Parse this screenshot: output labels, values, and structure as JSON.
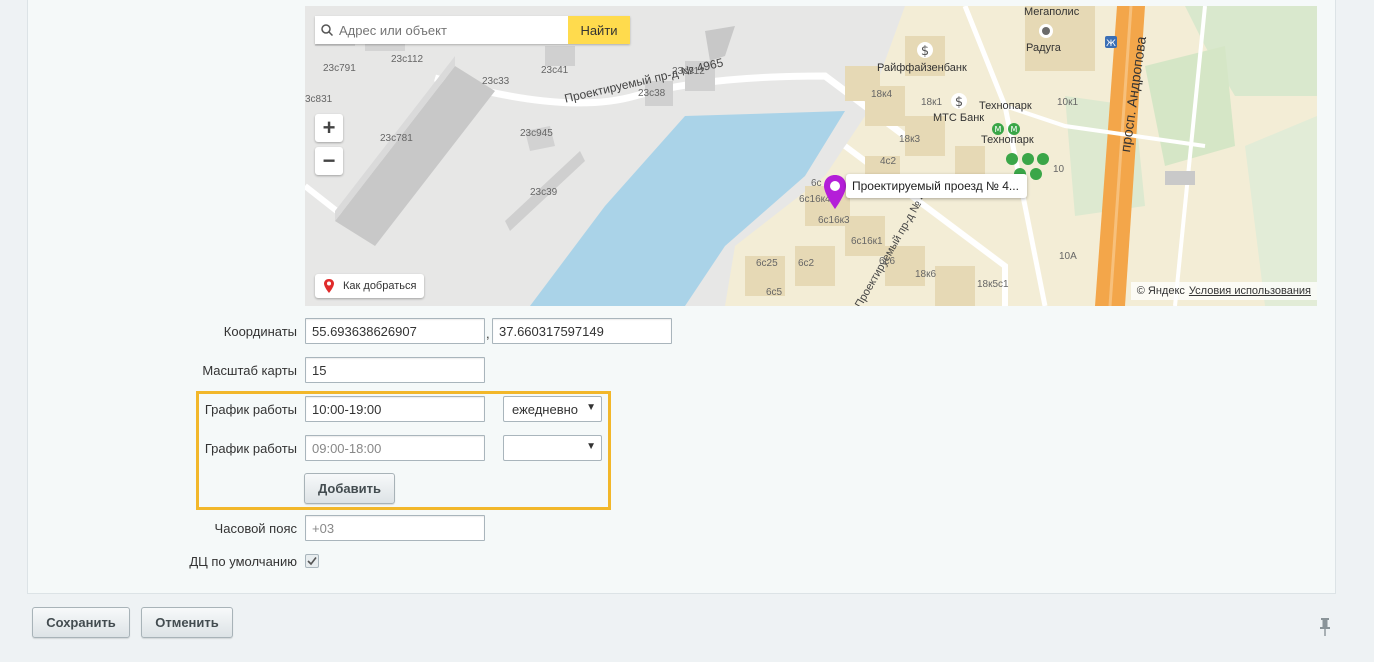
{
  "map": {
    "search_placeholder": "Адрес или объект",
    "search_button": "Найти",
    "zoom_in": "+",
    "zoom_out": "−",
    "route_button": "Как добраться",
    "balloon_text": "Проектируемый проезд № 4...",
    "copyright": "© Яндекс",
    "terms_link": "Условия использования",
    "labels": {
      "b1": "23с791",
      "b2": "23с112",
      "b3": "23с33",
      "b4": "23с41",
      "b5": "23с712",
      "b6": "23с38",
      "b7": "3с831",
      "b8": "23с781",
      "b9": "23с945",
      "b10": "23с39",
      "road1": "Проектируемый пр-д № 4965",
      "road2": "просп. Андропова",
      "road3": "Проектируемый пр-д № 4",
      "poi1": "Мегаполис",
      "poi2": "Радуга",
      "poi3": "Райффайзенбанк",
      "poi4": "МТС Банк",
      "poi5": "Технопарк",
      "poi6": "Технопарк",
      "b11": "18к4",
      "b12": "18к1",
      "b13": "18к3",
      "b14": "10к1",
      "b15": "4с2",
      "b16": "6с16к4",
      "b17": "6с16к3",
      "b18": "6с16к1",
      "b19": "6с25",
      "b20": "6с2",
      "b21": "6с6",
      "b22": "18к6",
      "b23": "6с5",
      "b24": "18к5с1",
      "b25": "10А",
      "b26": "10",
      "b27": "6с"
    }
  },
  "form": {
    "coordinates_label": "Координаты",
    "latitude": "55.693638626907",
    "longitude": "37.660317597149",
    "coord_separator": ",",
    "map_scale_label": "Масштаб карты",
    "map_scale": "15",
    "schedule1_label": "График работы",
    "schedule1_value": "10:00-19:00",
    "schedule1_period": "ежедневно",
    "schedule2_label": "График работы",
    "schedule2_placeholder": "09:00-18:00",
    "schedule2_period": "",
    "add_button": "Добавить",
    "timezone_label": "Часовой пояс",
    "timezone_placeholder": "+03",
    "default_dc_label": "ДЦ по умолчанию",
    "default_dc_checked": true
  },
  "footer": {
    "save_button": "Сохранить",
    "cancel_button": "Отменить"
  },
  "colors": {
    "highlight": "#f2b72a",
    "search_button": "#ffdb4d",
    "water": "#aad3e8",
    "marker": "#b41ed8"
  }
}
